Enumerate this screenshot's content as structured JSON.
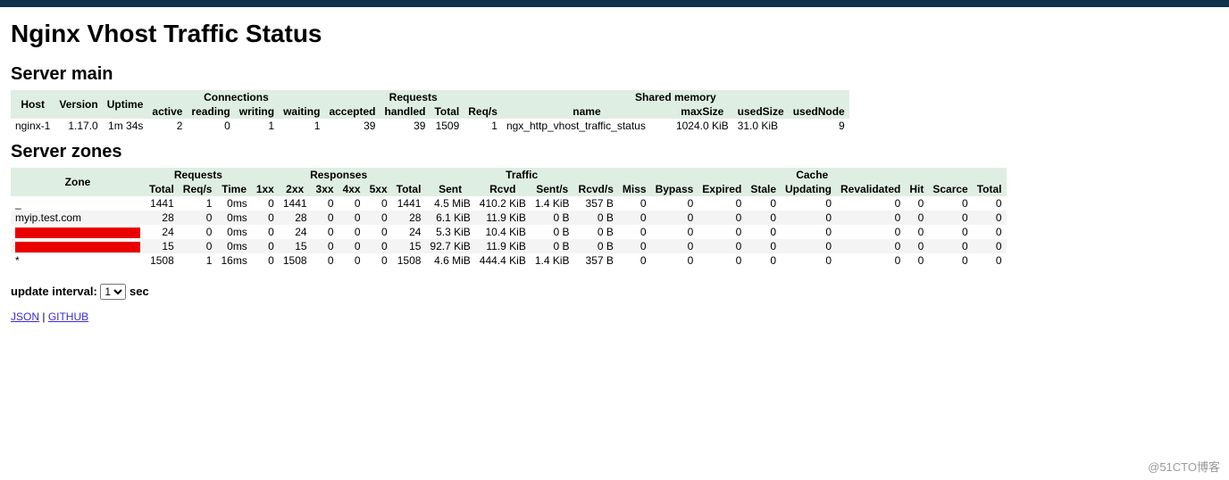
{
  "title": "Nginx Vhost Traffic Status",
  "section_main": "Server main",
  "section_zones": "Server zones",
  "main": {
    "groups": {
      "connections": "Connections",
      "requests": "Requests",
      "shared": "Shared memory"
    },
    "headers": {
      "host": "Host",
      "version": "Version",
      "uptime": "Uptime",
      "active": "active",
      "reading": "reading",
      "writing": "writing",
      "waiting": "waiting",
      "accepted": "accepted",
      "handled": "handled",
      "totalreq": "Total",
      "reqs": "Req/s",
      "name": "name",
      "maxsize": "maxSize",
      "usedsize": "usedSize",
      "usednode": "usedNode"
    },
    "row": {
      "host": "nginx-1",
      "version": "1.17.0",
      "uptime": "1m 34s",
      "active": "2",
      "reading": "0",
      "writing": "1",
      "waiting": "1",
      "accepted": "39",
      "handled": "39",
      "totalreq": "1509",
      "reqs": "1",
      "name": "ngx_http_vhost_traffic_status",
      "maxsize": "1024.0 KiB",
      "usedsize": "31.0 KiB",
      "usednode": "9"
    }
  },
  "zones": {
    "groups": {
      "zone": "Zone",
      "requests": "Requests",
      "responses": "Responses",
      "traffic": "Traffic",
      "cache": "Cache"
    },
    "headers": {
      "total": "Total",
      "reqs": "Req/s",
      "time": "Time",
      "r1": "1xx",
      "r2": "2xx",
      "r3": "3xx",
      "r4": "4xx",
      "r5": "5xx",
      "rtotal": "Total",
      "sent": "Sent",
      "rcvd": "Rcvd",
      "sents": "Sent/s",
      "rcvds": "Rcvd/s",
      "miss": "Miss",
      "bypass": "Bypass",
      "expired": "Expired",
      "stale": "Stale",
      "updating": "Updating",
      "revalidated": "Revalidated",
      "hit": "Hit",
      "scarce": "Scarce",
      "ctotal": "Total"
    },
    "rows": [
      {
        "zone": "_",
        "total": "1441",
        "reqs": "1",
        "time": "0ms",
        "r1": "0",
        "r2": "1441",
        "r3": "0",
        "r4": "0",
        "r5": "0",
        "rtotal": "1441",
        "sent": "4.5 MiB",
        "rcvd": "410.2 KiB",
        "sents": "1.4 KiB",
        "rcvds": "357 B",
        "miss": "0",
        "bypass": "0",
        "expired": "0",
        "stale": "0",
        "updating": "0",
        "revalidated": "0",
        "hit": "0",
        "scarce": "0",
        "ctotal": "0"
      },
      {
        "zone": "myip.test.com",
        "total": "28",
        "reqs": "0",
        "time": "0ms",
        "r1": "0",
        "r2": "28",
        "r3": "0",
        "r4": "0",
        "r5": "0",
        "rtotal": "28",
        "sent": "6.1 KiB",
        "rcvd": "11.9 KiB",
        "sents": "0 B",
        "rcvds": "0 B",
        "miss": "0",
        "bypass": "0",
        "expired": "0",
        "stale": "0",
        "updating": "0",
        "revalidated": "0",
        "hit": "0",
        "scarce": "0",
        "ctotal": "0"
      },
      {
        "zone": "REDACTED-1",
        "total": "24",
        "reqs": "0",
        "time": "0ms",
        "r1": "0",
        "r2": "24",
        "r3": "0",
        "r4": "0",
        "r5": "0",
        "rtotal": "24",
        "sent": "5.3 KiB",
        "rcvd": "10.4 KiB",
        "sents": "0 B",
        "rcvds": "0 B",
        "miss": "0",
        "bypass": "0",
        "expired": "0",
        "stale": "0",
        "updating": "0",
        "revalidated": "0",
        "hit": "0",
        "scarce": "0",
        "ctotal": "0"
      },
      {
        "zone": "REDACTED-2",
        "total": "15",
        "reqs": "0",
        "time": "0ms",
        "r1": "0",
        "r2": "15",
        "r3": "0",
        "r4": "0",
        "r5": "0",
        "rtotal": "15",
        "sent": "92.7 KiB",
        "rcvd": "11.9 KiB",
        "sents": "0 B",
        "rcvds": "0 B",
        "miss": "0",
        "bypass": "0",
        "expired": "0",
        "stale": "0",
        "updating": "0",
        "revalidated": "0",
        "hit": "0",
        "scarce": "0",
        "ctotal": "0"
      },
      {
        "zone": "*",
        "total": "1508",
        "reqs": "1",
        "time": "16ms",
        "r1": "0",
        "r2": "1508",
        "r3": "0",
        "r4": "0",
        "r5": "0",
        "rtotal": "1508",
        "sent": "4.6 MiB",
        "rcvd": "444.4 KiB",
        "sents": "1.4 KiB",
        "rcvds": "357 B",
        "miss": "0",
        "bypass": "0",
        "expired": "0",
        "stale": "0",
        "updating": "0",
        "revalidated": "0",
        "hit": "0",
        "scarce": "0",
        "ctotal": "0"
      }
    ]
  },
  "footer": {
    "update_label": "update interval:",
    "sec_label": "sec",
    "interval_value": "1",
    "json": "JSON",
    "github": "GITHUB"
  },
  "watermark": "@51CTO博客"
}
